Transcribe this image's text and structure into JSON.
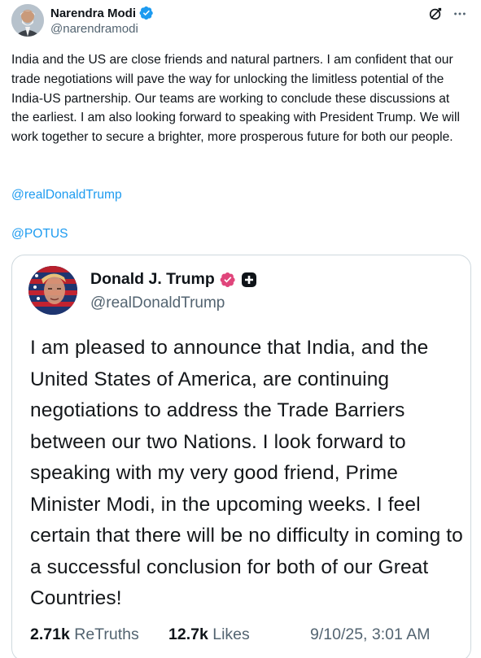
{
  "tweet": {
    "author_name": "Narendra Modi",
    "author_handle": "@narendramodi",
    "body": "India and the US are close friends and natural partners. I am confident that our trade negotiations will pave the way for unlocking the limitless potential of the India-US partnership. Our teams are working to conclude these discussions at the earliest. I am also looking forward to speaking with President Trump. We will work together to secure a brighter, more prosperous future for both our people.",
    "mentions": [
      "@realDonaldTrump",
      "@POTUS"
    ]
  },
  "quote": {
    "author_name": "Donald J. Trump",
    "author_handle": "@realDonaldTrump",
    "body": "I am pleased to announce that India, and the United States of America, are continuing negotiations to address the Trade Barriers between our two Nations. I look forward to speaking with my very good friend, Prime Minister Modi, in the upcoming weeks. I feel certain that there will be no difficulty in coming to a successful conclusion for both of our Great Countries!",
    "retruths_count": "2.71k",
    "retruths_label": "ReTruths",
    "likes_count": "12.7k",
    "likes_label": "Likes",
    "timestamp": "9/10/25, 3:01 AM"
  },
  "icons": {
    "verified": "verified-badge-icon",
    "grok": "grok-icon",
    "more": "more-options-icon",
    "quote_verified": "truth-verified-badge-icon",
    "quote_plus": "plus-badge-icon"
  },
  "colors": {
    "link": "#1d9bf0",
    "secondary_text": "#536471",
    "verified": "#1d9bf0",
    "truth_badge": "#e0457b"
  }
}
